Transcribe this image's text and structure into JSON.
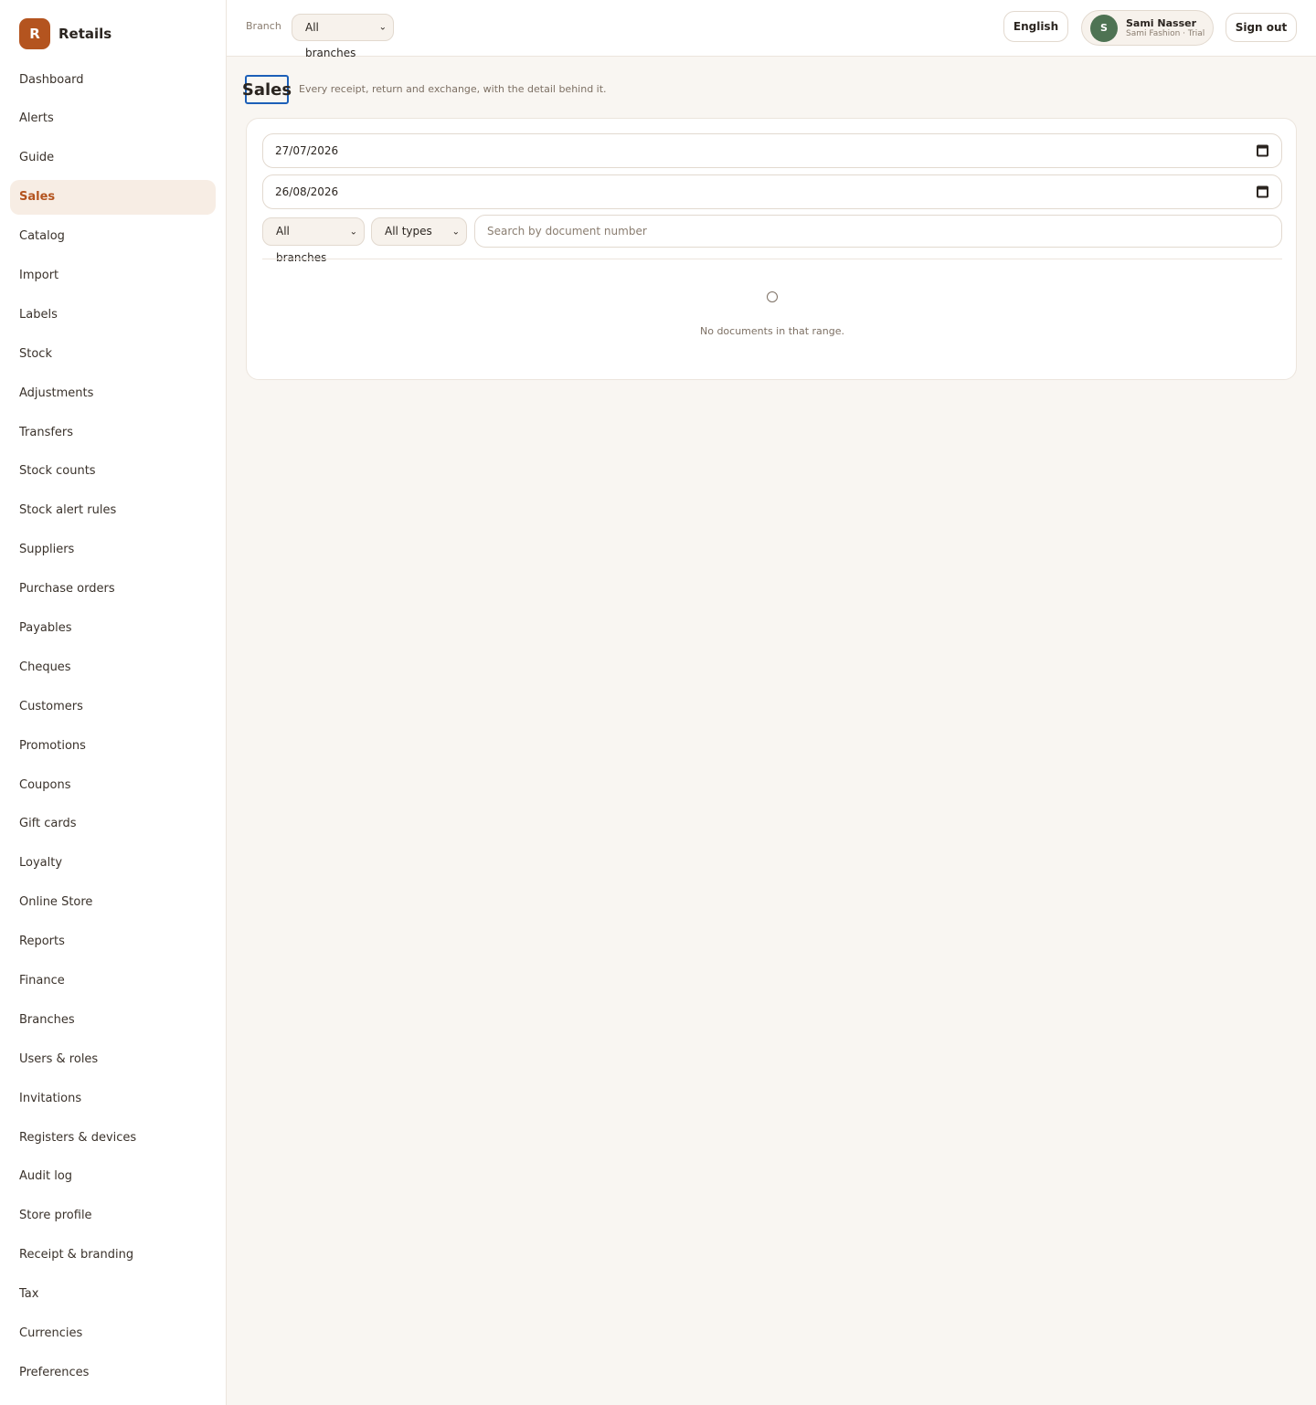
{
  "brand": {
    "logo_letter": "R",
    "name": "Retails",
    "accent": "#b4541f"
  },
  "sidebar": {
    "items": [
      {
        "label": "Dashboard"
      },
      {
        "label": "Alerts"
      },
      {
        "label": "Guide"
      },
      {
        "label": "Sales",
        "active": true
      },
      {
        "label": "Catalog"
      },
      {
        "label": "Import"
      },
      {
        "label": "Labels"
      },
      {
        "label": "Stock"
      },
      {
        "label": "Adjustments"
      },
      {
        "label": "Transfers"
      },
      {
        "label": "Stock counts"
      },
      {
        "label": "Stock alert rules"
      },
      {
        "label": "Suppliers"
      },
      {
        "label": "Purchase orders"
      },
      {
        "label": "Payables"
      },
      {
        "label": "Cheques"
      },
      {
        "label": "Customers"
      },
      {
        "label": "Promotions"
      },
      {
        "label": "Coupons"
      },
      {
        "label": "Gift cards"
      },
      {
        "label": "Loyalty"
      },
      {
        "label": "Online Store"
      },
      {
        "label": "Reports"
      },
      {
        "label": "Finance"
      },
      {
        "label": "Branches"
      },
      {
        "label": "Users & roles"
      },
      {
        "label": "Invitations"
      },
      {
        "label": "Registers & devices"
      },
      {
        "label": "Audit log"
      },
      {
        "label": "Store profile"
      },
      {
        "label": "Receipt & branding"
      },
      {
        "label": "Tax"
      },
      {
        "label": "Currencies"
      },
      {
        "label": "Preferences"
      }
    ]
  },
  "header": {
    "branch_label": "Branch",
    "branch_select": "All branches",
    "language_button": "English",
    "user": {
      "avatar_letter": "S",
      "name": "Sami Nasser",
      "org": "Sami Fashion · Trial",
      "avatar_color": "#4e7353"
    },
    "sign_out": "Sign out"
  },
  "page": {
    "title": "Sales",
    "subtitle": "Every receipt, return and exchange, with the detail behind it."
  },
  "filters": {
    "date_from": "27/07/2026",
    "date_to": "26/08/2026",
    "branch_select": "All branches",
    "type_select": "All types",
    "search_placeholder": "Search by document number",
    "search_value": ""
  },
  "results": {
    "empty_message": "No documents in that range."
  }
}
